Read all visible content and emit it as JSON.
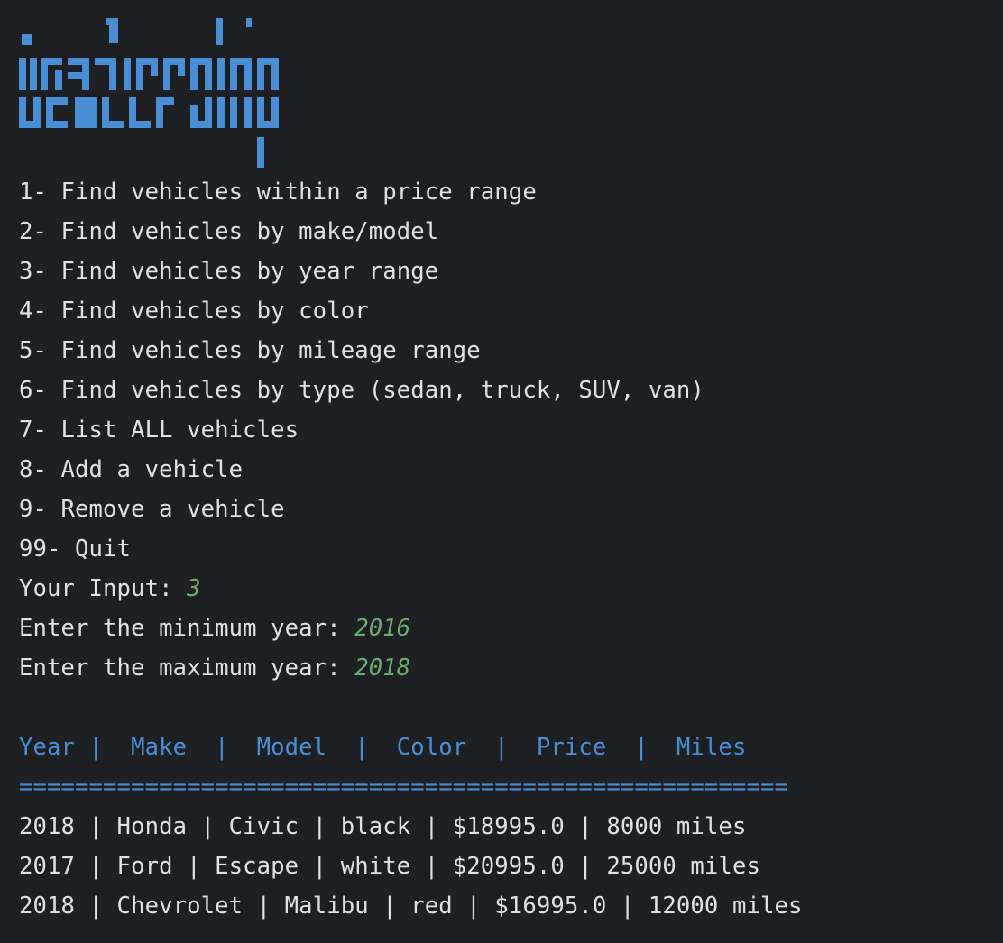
{
  "colors": {
    "background": "#1e1f22",
    "text": "#dfe1e5",
    "accent_blue": "#4a8fd6",
    "input_green": "#6aab73"
  },
  "menu": [
    "1- Find vehicles within a price range",
    "2- Find vehicles by make/model",
    "3- Find vehicles by year range",
    "4- Find vehicles by color",
    "5- Find vehicles by mileage range",
    "6- Find vehicles by type (sedan, truck, SUV, van)",
    "7- List ALL vehicles",
    "8- Add a vehicle",
    "9- Remove a vehicle",
    "99- Quit"
  ],
  "prompts": {
    "input_label": "Your Input: ",
    "input_value": "3",
    "min_year_label": "Enter the minimum year: ",
    "min_year_value": "2016",
    "max_year_label": "Enter the maximum year: ",
    "max_year_value": "2018"
  },
  "table": {
    "header": "Year |  Make  |  Model  |  Color  |  Price  |  Miles",
    "separator": "=======================================================",
    "rows": [
      "2018 | Honda | Civic | black | $18995.0 | 8000 miles",
      "2017 | Ford | Escape | white | $20995.0 | 25000 miles",
      "2018 | Chevrolet | Malibu | red | $16995.0 | 12000 miles"
    ]
  }
}
